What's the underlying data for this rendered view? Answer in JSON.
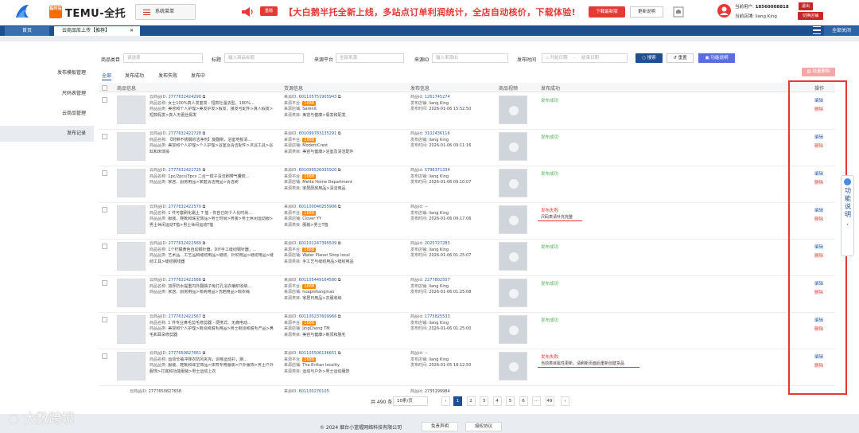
{
  "header": {
    "brand_badge": "临时站",
    "brand_name": "TEMU-全托",
    "menu_label": "系统菜单",
    "new_tag": "重磅",
    "ticker": "【大白鹅半托全新上线，多站点订单利润统计，全店自动核价，下载体验!",
    "download_label": "下载最新版",
    "help_label": "更新说明",
    "user_label": "当前用户:",
    "user_phone": "18560008818",
    "store_label": "当前店铺:",
    "store_name": "liang King",
    "logout_label": "退出",
    "switch_label": "切换店铺"
  },
  "tabs": {
    "home": "首页",
    "current": "云商品库上传【推荐】",
    "close_all": "全部关闭"
  },
  "sidebar": {
    "items": [
      {
        "label": "发布模板管理"
      },
      {
        "label": "尺码表管理"
      },
      {
        "label": "云商品管理"
      },
      {
        "label": "发布记录"
      }
    ]
  },
  "filters": {
    "category_label": "商品类目",
    "category_placeholder": "请选择",
    "title_label": "标题",
    "title_placeholder": "输入商品标题",
    "source_label": "来源平台",
    "source_placeholder": "全部来源",
    "source_id_label": "来源ID",
    "source_id_placeholder": "输入来源ID",
    "time_label": "发布时间",
    "start_placeholder": "开始日期",
    "date_sep": "-",
    "end_placeholder": "结束日期",
    "search_label": "搜索",
    "reset_label": "重置",
    "guide_label": "功能说明",
    "batch_delete_label": "批量删除"
  },
  "subtabs": [
    "全部",
    "发布成功",
    "发布失败",
    "发布中"
  ],
  "table": {
    "headers": [
      "商品信息",
      "货源信息",
      "发布信息",
      "商品视频",
      "发布成功",
      "操作"
    ],
    "label_cloud_id": "云商品ID:",
    "label_name": "商品名称:",
    "label_category": "商品品类:",
    "label_source_id": "来源ID:",
    "label_platform": "来源平台:",
    "label_shop": "来源店铺:",
    "label_source_cat": "来源类目:",
    "label_product_id": "商品id:",
    "label_pub_store": "发布店铺:",
    "label_pub_time": "发布时间:",
    "platform_badge": "1688",
    "edit_label": "编辑",
    "delete_label": "删除",
    "rows": [
      {
        "cloud_id": "2777632424290",
        "name": "女士100%真人发套发 - 短款社温浓型，180%...",
        "category": "美容和个人护理>美发护发>假发，接发与配件>真人假发>短款假发>真人无蕾丝假发",
        "source_id": "601105751905943",
        "shop": "Sarenit",
        "source_cat": "美容与健康>假发和配发",
        "product_id": "1261745274",
        "pub_store": "liang King",
        "pub_time": "2026-01-06 15:52:50",
        "status": "发布成功",
        "status_type": "ok",
        "message": ""
      },
      {
        "cloud_id": "2777632422728",
        "name": "【附带不锈钢的洁净剂】旋翻刷，浴室地板清...",
        "category": "美容和个人护理>个人护理>浴室及清洁配件>沐浴工具>浴缸和床体操",
        "source_id": "601099783135291",
        "shop": "ModernCrest",
        "source_cat": "美容与健康>浴室及清洁配件",
        "product_id": "3102436116",
        "pub_store": "liang King",
        "pub_time": "2026-01-06 09:11:16",
        "status": "发布成功",
        "status_type": "ok",
        "message": ""
      },
      {
        "cloud_id": "2777632422725",
        "name": "1pc/2pcs/3pcs 二合一梳子清洁刷带气囊梳...",
        "category": "家居、厨房用品>家庭清洁用品>清洁刷",
        "source_id": "601099526095920",
        "shop": "Mette Home Department",
        "source_cat": "家居厨房用品>清洁用品",
        "product_id": "5796371334",
        "pub_store": "liang King",
        "pub_time": "2026-01-06 09:10:07",
        "status": "发布成功",
        "status_type": "ok",
        "message": ""
      },
      {
        "cloud_id": "2777632422570",
        "name": "1 件可套刷化霜土 T 恤 - 你自己的个人化时尚...",
        "category": "服装、鞋靴和珠宝饰品>男士时尚>男装>男士休闲运动服>男士休闲运动T恤>男士休闲运动T恤",
        "source_id": "601100040255906",
        "shop": "Clover YY",
        "source_cat": "服装>男士T恤",
        "product_id": "--",
        "pub_store": "liang King",
        "pub_time": "2026-01-06 09:17:06",
        "status": "发布失败",
        "status_type": "fail",
        "message": "尺码表请补充完整"
      },
      {
        "cloud_id": "2777632422569",
        "name": "1个柠檬黄色自动钢针器，DIY手工缝纫钢针器，...",
        "category": "艺术品、工艺品和缝纫用品>缝纫、针织用品>缝纫用品>缝纫工具>缝纫钢线器",
        "source_id": "601101247395509",
        "shop": "Water Planet Shop local",
        "source_cat": "手工艺与缝纫用品>缝纫用品",
        "product_id": "2025727283",
        "pub_store": "liang King",
        "pub_time": "2026-01-06 01:25:07",
        "status": "发布成功",
        "status_type": "ok",
        "message": ""
      },
      {
        "cloud_id": "2777632422568",
        "name": "加厚防水提重内外翻袋子免打孔浴衣编织收纳...",
        "category": "家居、厨房用品>收纳用品>洗晒用品>晾衣绳",
        "source_id": "601105449164580",
        "shop": "huapishangmao",
        "source_cat": "家居日用品>衣服收纳",
        "product_id": "2277802507",
        "pub_store": "liang King",
        "pub_time": "2026-01-06 01:25:08",
        "status": "发布成功",
        "status_type": "ok",
        "message": ""
      },
      {
        "cloud_id": "2777632422567",
        "name": "1 件专业鼻毛剪毛修剪器 - 便携式、无痛电动...",
        "category": "美容和个人护理>剃须和脱毛用品>男士剃须和脱毛产品>鼻毛和耳朵修剪器",
        "source_id": "601100237609966",
        "shop": "JingCheng TM",
        "source_cat": "美容与健康>剃须和脱毛",
        "product_id": "1775825533",
        "pub_store": "liang King",
        "pub_time": "2026-01-06 01:25:00",
        "status": "发布成功",
        "status_type": "ok",
        "message": ""
      },
      {
        "cloud_id": "2777650827661",
        "name": "运动长袖冲锋衣防风夹克，训练运动衫，跑...",
        "category": "服装、鞋靴和珠宝饰品>体育专用服装>户外服饰>男士户外服饰>打底和功能服装>男士运动上衣",
        "source_id": "601105506136651",
        "shop": "The Eriitan locality",
        "source_cat": "运动与户外>男士运动服饰",
        "product_id": "--",
        "pub_store": "liang King",
        "pub_time": "2026-01-05 18:12:50",
        "status": "发布失败",
        "status_type": "fail",
        "message": "当前类目属性更新，请刷新页面后重新创建货品"
      }
    ],
    "partial_row": {
      "cloud_id": "2777650827658",
      "source_id": "601100270105",
      "product_id": "2735199984"
    }
  },
  "pagination": {
    "total": "共 490 条",
    "page_size": "10条/页",
    "prev": "‹",
    "pages": [
      "1",
      "2",
      "3",
      "4",
      "5",
      "6",
      "···",
      "49"
    ],
    "next": "›",
    "active_page": "1"
  },
  "float_help": "功能说明",
  "footer": {
    "copyright": "© 2024 烟台小篮幄网络科技有限公司",
    "disclaimer": "免责声明",
    "agreement": "授权协议"
  },
  "watermark": "大数跨境",
  "colors": {
    "brand_blue": "#1e4f8f",
    "alert_red": "#e53935",
    "success_green": "#4caf50",
    "link_blue": "#2a5caa"
  }
}
